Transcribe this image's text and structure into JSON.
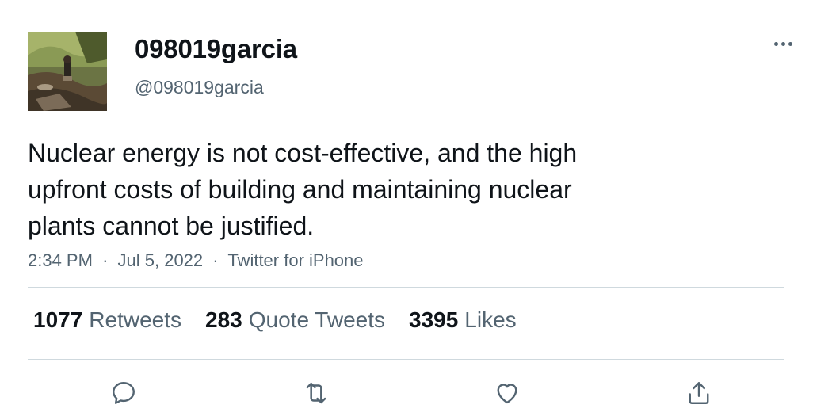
{
  "user": {
    "display_name": "098019garcia",
    "handle": "@098019garcia",
    "avatar_icon": "profile-photo"
  },
  "tweet": {
    "text": "Nuclear energy is not cost-effective, and the high\nupfront costs of building and maintaining nuclear\nplants cannot be justified.",
    "time": "2:34 PM",
    "date": "Jul 5, 2022",
    "source": "Twitter for iPhone",
    "separator": "·"
  },
  "stats": {
    "retweets": {
      "count": "1077",
      "label": "Retweets"
    },
    "quotes": {
      "count": "283",
      "label": "Quote Tweets"
    },
    "likes": {
      "count": "3395",
      "label": "Likes"
    }
  },
  "actions": [
    "reply-icon",
    "retweet-icon",
    "like-icon",
    "share-icon"
  ],
  "colors": {
    "text_primary": "#0f1419",
    "text_secondary": "#536471",
    "divider": "#cfd9de"
  }
}
